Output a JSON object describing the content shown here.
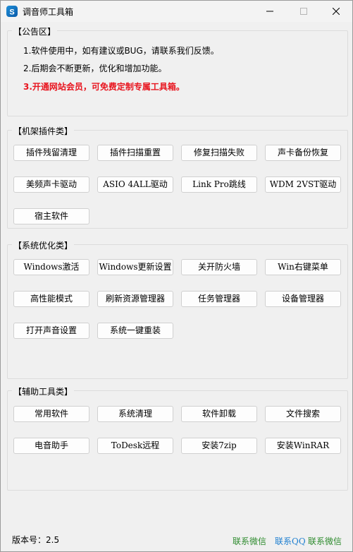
{
  "window": {
    "title": "调音师工具箱"
  },
  "notice": {
    "title": "【公告区】",
    "lines": [
      "1.软件使用中，如有建议或BUG，请联系我们反馈。",
      "2.后期会不断更新，优化和增加功能。",
      "3.开通网站会员，可免费定制专属工具箱。"
    ],
    "highlight_color": "#e8141e"
  },
  "rack": {
    "title": "【机架插件类】",
    "buttons": [
      "插件残留清理",
      "插件扫描重置",
      "修复扫描失败",
      "声卡备份恢复",
      "美频声卡驱动",
      "ASIO 4ALL驱动",
      "Link Pro跳线",
      "WDM 2VST驱动",
      "宿主软件"
    ]
  },
  "system": {
    "title": "【系统优化类】",
    "buttons": [
      "Windows激活",
      "Windows更新设置",
      "关开防火墙",
      "Win右键菜单",
      "高性能模式",
      "刷新资源管理器",
      "任务管理器",
      "设备管理器",
      "打开声音设置",
      "系统一键重装"
    ]
  },
  "tools": {
    "title": "【辅助工具类】",
    "buttons": [
      "常用软件",
      "系统清理",
      "软件卸载",
      "文件搜索",
      "电音助手",
      "ToDesk远程",
      "安装7zip",
      "安装WinRAR"
    ]
  },
  "footer": {
    "version": "版本号：2.5",
    "links": [
      "联系微信",
      "联系QQ",
      "联系微信"
    ],
    "link_colors": [
      "#2e8b2e",
      "#1e7fd0",
      "#2e8b2e"
    ]
  }
}
